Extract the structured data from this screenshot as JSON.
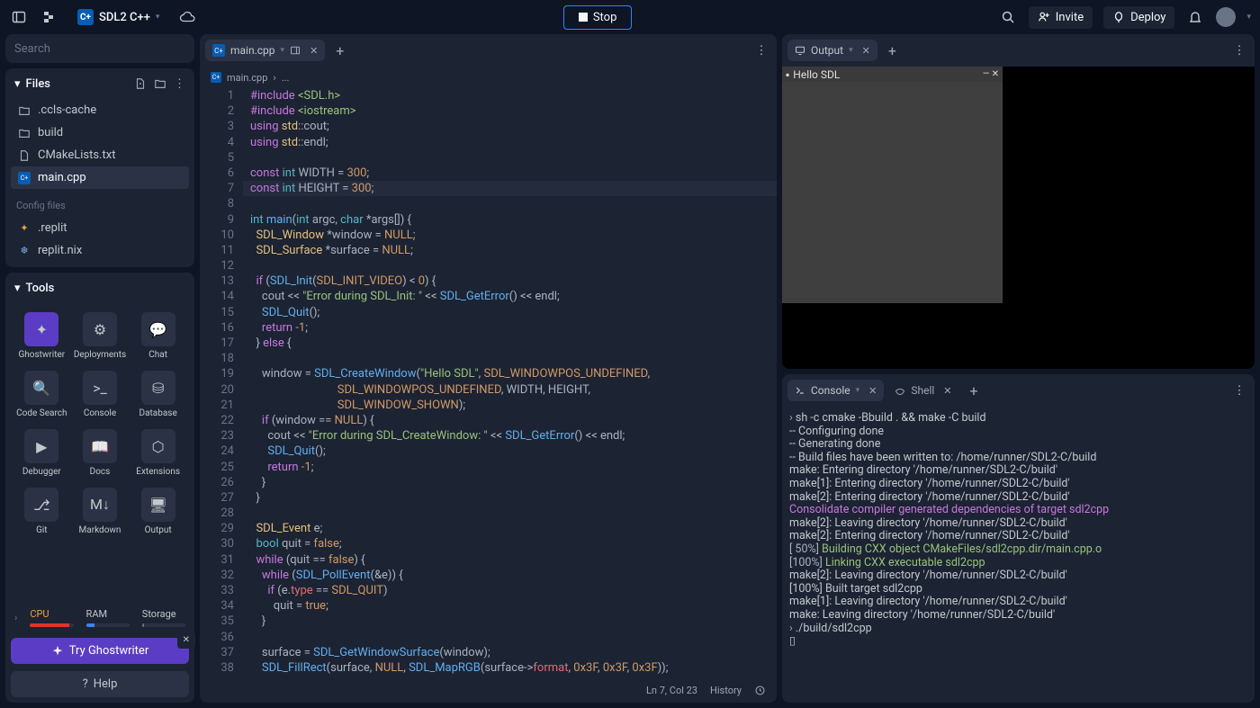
{
  "topbar": {
    "project_name": "SDL2 C++",
    "stop_label": "Stop",
    "invite_label": "Invite",
    "deploy_label": "Deploy"
  },
  "sidebar": {
    "search_placeholder": "Search",
    "files_header": "Files",
    "files": [
      {
        "name": ".ccls-cache",
        "type": "folder"
      },
      {
        "name": "build",
        "type": "folder"
      },
      {
        "name": "CMakeLists.txt",
        "type": "file"
      },
      {
        "name": "main.cpp",
        "type": "cpp",
        "active": true
      }
    ],
    "config_label": "Config files",
    "config_files": [
      {
        "name": ".replit"
      },
      {
        "name": "replit.nix"
      }
    ],
    "tools_header": "Tools",
    "tools": [
      {
        "label": "Ghostwriter"
      },
      {
        "label": "Deployments"
      },
      {
        "label": "Chat"
      },
      {
        "label": "Code Search"
      },
      {
        "label": "Console"
      },
      {
        "label": "Database"
      },
      {
        "label": "Debugger"
      },
      {
        "label": "Docs"
      },
      {
        "label": "Extensions"
      },
      {
        "label": "Git"
      },
      {
        "label": "Markdown"
      },
      {
        "label": "Output"
      }
    ],
    "resources": {
      "cpu": "CPU",
      "ram": "RAM",
      "storage": "Storage"
    },
    "ghostwriter_cta": "Try Ghostwriter",
    "help_label": "Help"
  },
  "editor": {
    "tab_name": "main.cpp",
    "breadcrumb1": "main.cpp",
    "breadcrumb2": "...",
    "status_pos": "Ln 7, Col 23",
    "status_history": "History",
    "code": [
      {
        "n": 1,
        "html": "<span class='tok-pp'>#include</span> <span class='tok-str'>&lt;SDL.h&gt;</span>"
      },
      {
        "n": 2,
        "html": "<span class='tok-pp'>#include</span> <span class='tok-str'>&lt;iostream&gt;</span>"
      },
      {
        "n": 3,
        "html": "<span class='tok-kw'>using</span> <span class='tok-ident'>std</span><span class='tok-plain'>::cout;</span>"
      },
      {
        "n": 4,
        "html": "<span class='tok-kw'>using</span> <span class='tok-ident'>std</span><span class='tok-plain'>::endl;</span>"
      },
      {
        "n": 5,
        "html": ""
      },
      {
        "n": 6,
        "html": "<span class='tok-kw'>const</span> <span class='tok-type'>int</span> <span class='tok-plain'>WIDTH = </span><span class='tok-num'>300</span><span class='tok-plain'>;</span>"
      },
      {
        "n": 7,
        "hl": true,
        "html": "<span class='tok-kw'>const</span> <span class='tok-type'>int</span> <span class='tok-plain'>HEIGHT = </span><span class='tok-num'>300</span><span class='tok-plain'>;</span>"
      },
      {
        "n": 8,
        "html": ""
      },
      {
        "n": 9,
        "html": "<span class='tok-type'>int</span> <span class='tok-fn'>main</span><span class='tok-plain'>(</span><span class='tok-type'>int</span> <span class='tok-plain'>argc, </span><span class='tok-type'>char</span> <span class='tok-plain'>*args[]) {</span>"
      },
      {
        "n": 10,
        "html": "  <span class='tok-ident'>SDL_Window</span> <span class='tok-plain'>*window = </span><span class='tok-const'>NULL</span><span class='tok-plain'>;</span>"
      },
      {
        "n": 11,
        "html": "  <span class='tok-ident'>SDL_Surface</span> <span class='tok-plain'>*surface = </span><span class='tok-const'>NULL</span><span class='tok-plain'>;</span>"
      },
      {
        "n": 12,
        "html": ""
      },
      {
        "n": 13,
        "html": "  <span class='tok-kw'>if</span> <span class='tok-plain'>(</span><span class='tok-fn'>SDL_Init</span><span class='tok-plain'>(</span><span class='tok-const'>SDL_INIT_VIDEO</span><span class='tok-plain'>) &lt; </span><span class='tok-num'>0</span><span class='tok-plain'>) {</span>"
      },
      {
        "n": 14,
        "html": "    <span class='tok-plain'>cout &lt;&lt; </span><span class='tok-str'>\"Error during SDL_Init: \"</span> <span class='tok-plain'>&lt;&lt; </span><span class='tok-fn'>SDL_GetError</span><span class='tok-plain'>() &lt;&lt; endl;</span>"
      },
      {
        "n": 15,
        "html": "    <span class='tok-fn'>SDL_Quit</span><span class='tok-plain'>();</span>"
      },
      {
        "n": 16,
        "html": "    <span class='tok-kw'>return</span> <span class='tok-num'>-1</span><span class='tok-plain'>;</span>"
      },
      {
        "n": 17,
        "html": "  <span class='tok-plain'>} </span><span class='tok-kw'>else</span> <span class='tok-plain'>{</span>"
      },
      {
        "n": 18,
        "html": ""
      },
      {
        "n": 19,
        "html": "    <span class='tok-plain'>window = </span><span class='tok-fn'>SDL_CreateWindow</span><span class='tok-plain'>(</span><span class='tok-str'>\"Hello SDL\"</span><span class='tok-plain'>, </span><span class='tok-const'>SDL_WINDOWPOS_UNDEFINED</span><span class='tok-plain'>,</span>"
      },
      {
        "n": 20,
        "html": "                              <span class='tok-const'>SDL_WINDOWPOS_UNDEFINED</span><span class='tok-plain'>, WIDTH, HEIGHT,</span>"
      },
      {
        "n": 21,
        "html": "                              <span class='tok-const'>SDL_WINDOW_SHOWN</span><span class='tok-plain'>);</span>"
      },
      {
        "n": 22,
        "html": "    <span class='tok-kw'>if</span> <span class='tok-plain'>(window == </span><span class='tok-const'>NULL</span><span class='tok-plain'>) {</span>"
      },
      {
        "n": 23,
        "html": "      <span class='tok-plain'>cout &lt;&lt; </span><span class='tok-str'>\"Error during SDL_CreateWindow: \"</span> <span class='tok-plain'>&lt;&lt; </span><span class='tok-fn'>SDL_GetError</span><span class='tok-plain'>() &lt;&lt; endl;</span>"
      },
      {
        "n": 24,
        "html": "      <span class='tok-fn'>SDL_Quit</span><span class='tok-plain'>();</span>"
      },
      {
        "n": 25,
        "html": "      <span class='tok-kw'>return</span> <span class='tok-num'>-1</span><span class='tok-plain'>;</span>"
      },
      {
        "n": 26,
        "html": "    <span class='tok-plain'>}</span>"
      },
      {
        "n": 27,
        "html": "  <span class='tok-plain'>}</span>"
      },
      {
        "n": 28,
        "html": ""
      },
      {
        "n": 29,
        "html": "  <span class='tok-ident'>SDL_Event</span> <span class='tok-plain'>e;</span>"
      },
      {
        "n": 30,
        "html": "  <span class='tok-type'>bool</span> <span class='tok-plain'>quit = </span><span class='tok-const'>false</span><span class='tok-plain'>;</span>"
      },
      {
        "n": 31,
        "html": "  <span class='tok-kw'>while</span> <span class='tok-plain'>(quit == </span><span class='tok-const'>false</span><span class='tok-plain'>) {</span>"
      },
      {
        "n": 32,
        "html": "    <span class='tok-kw'>while</span> <span class='tok-plain'>(</span><span class='tok-fn'>SDL_PollEvent</span><span class='tok-plain'>(&amp;e)) {</span>"
      },
      {
        "n": 33,
        "html": "      <span class='tok-kw'>if</span> <span class='tok-plain'>(e.</span><span class='tok-prop'>type</span> <span class='tok-plain'>== </span><span class='tok-const'>SDL_QUIT</span><span class='tok-plain'>)</span>"
      },
      {
        "n": 34,
        "html": "        <span class='tok-plain'>quit = </span><span class='tok-const'>true</span><span class='tok-plain'>;</span>"
      },
      {
        "n": 35,
        "html": "    <span class='tok-plain'>}</span>"
      },
      {
        "n": 36,
        "html": ""
      },
      {
        "n": 37,
        "html": "    <span class='tok-plain'>surface = </span><span class='tok-fn'>SDL_GetWindowSurface</span><span class='tok-plain'>(window);</span>"
      },
      {
        "n": 38,
        "html": "    <span class='tok-fn'>SDL_FillRect</span><span class='tok-plain'>(surface, </span><span class='tok-const'>NULL</span><span class='tok-plain'>, </span><span class='tok-fn'>SDL_MapRGB</span><span class='tok-plain'>(surface-&gt;</span><span class='tok-prop'>format</span><span class='tok-plain'>, </span><span class='tok-num'>0x3F</span><span class='tok-plain'>, </span><span class='tok-num'>0x3F</span><span class='tok-plain'>, </span><span class='tok-num'>0x3F</span><span class='tok-plain'>));</span>"
      }
    ]
  },
  "output": {
    "tab_label": "Output",
    "window_title": "Hello SDL"
  },
  "console": {
    "console_tab": "Console",
    "shell_tab": "Shell",
    "lines": [
      {
        "cls": "",
        "html": "<span class='prompt-caret'>›</span> sh -c cmake -Bbuild . && make -C build"
      },
      {
        "cls": "",
        "html": "-- Configuring done"
      },
      {
        "cls": "",
        "html": "-- Generating done"
      },
      {
        "cls": "",
        "html": "-- Build files have been written to: /home/runner/SDL2-C/build"
      },
      {
        "cls": "",
        "html": "make: Entering directory '/home/runner/SDL2-C/build'"
      },
      {
        "cls": "",
        "html": "make[1]: Entering directory '/home/runner/SDL2-C/build'"
      },
      {
        "cls": "",
        "html": "make[2]: Entering directory '/home/runner/SDL2-C/build'"
      },
      {
        "cls": "mag",
        "html": "Consolidate compiler generated dependencies of target sdl2cpp"
      },
      {
        "cls": "",
        "html": "make[2]: Leaving directory '/home/runner/SDL2-C/build'"
      },
      {
        "cls": "",
        "html": "make[2]: Entering directory '/home/runner/SDL2-C/build'"
      },
      {
        "cls": "",
        "html": "<span class='pct'>[ 50%]</span> <span class='grn'>Building CXX object CMakeFiles/sdl2cpp.dir/main.cpp.o</span>"
      },
      {
        "cls": "",
        "html": "<span class='pct'>[100%]</span> <span class='grn'>Linking CXX executable sdl2cpp</span>"
      },
      {
        "cls": "",
        "html": "make[2]: Leaving directory '/home/runner/SDL2-C/build'"
      },
      {
        "cls": "",
        "html": "[100%] Built target sdl2cpp"
      },
      {
        "cls": "",
        "html": "make[1]: Leaving directory '/home/runner/SDL2-C/build'"
      },
      {
        "cls": "",
        "html": "make: Leaving directory '/home/runner/SDL2-C/build'"
      },
      {
        "cls": "",
        "html": "<span class='prompt-caret'>›</span> ./build/sdl2cpp"
      },
      {
        "cls": "",
        "html": "▯"
      }
    ]
  }
}
